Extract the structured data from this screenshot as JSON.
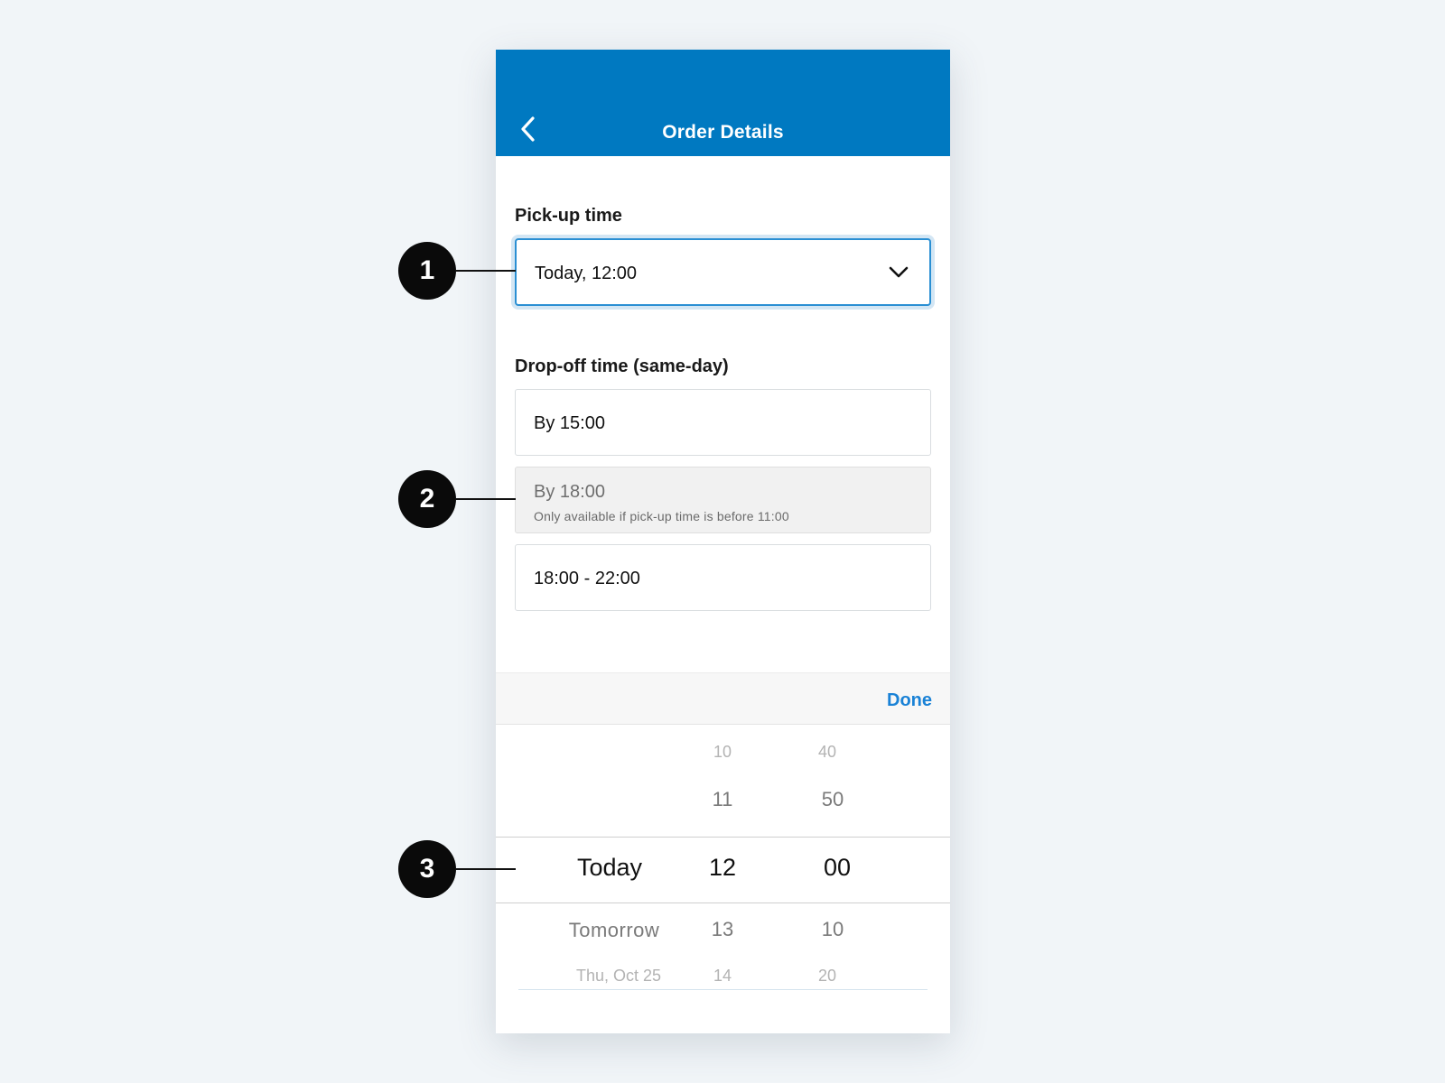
{
  "header": {
    "title": "Order Details",
    "back_icon": "chevron-left-icon",
    "color": "#0079c1"
  },
  "pickup": {
    "label": "Pick-up time",
    "value": "Today, 12:00",
    "dropdown_icon": "chevron-down-icon"
  },
  "dropoff": {
    "label": "Drop-off time (same-day)",
    "options": [
      {
        "label": "By 15:00",
        "enabled": true
      },
      {
        "label": "By 18:00",
        "sublabel": "Only available if pick-up time is before 11:00",
        "enabled": false
      },
      {
        "label": "18:00 - 22:00",
        "enabled": true
      }
    ]
  },
  "picker": {
    "done_label": "Done",
    "days": {
      "selected": "Today",
      "below": [
        "Tomorrow",
        "Thu, Oct 25"
      ]
    },
    "hours": {
      "above": [
        "10",
        "11"
      ],
      "selected": "12",
      "below": [
        "13",
        "14"
      ]
    },
    "minutes": {
      "above": [
        "40",
        "50"
      ],
      "selected": "00",
      "below": [
        "10",
        "20"
      ]
    }
  },
  "callouts": [
    "1",
    "2",
    "3"
  ],
  "colors": {
    "accent": "#1a82d6",
    "focus_border": "#2a8fd3",
    "background": "#f1f5f8"
  }
}
